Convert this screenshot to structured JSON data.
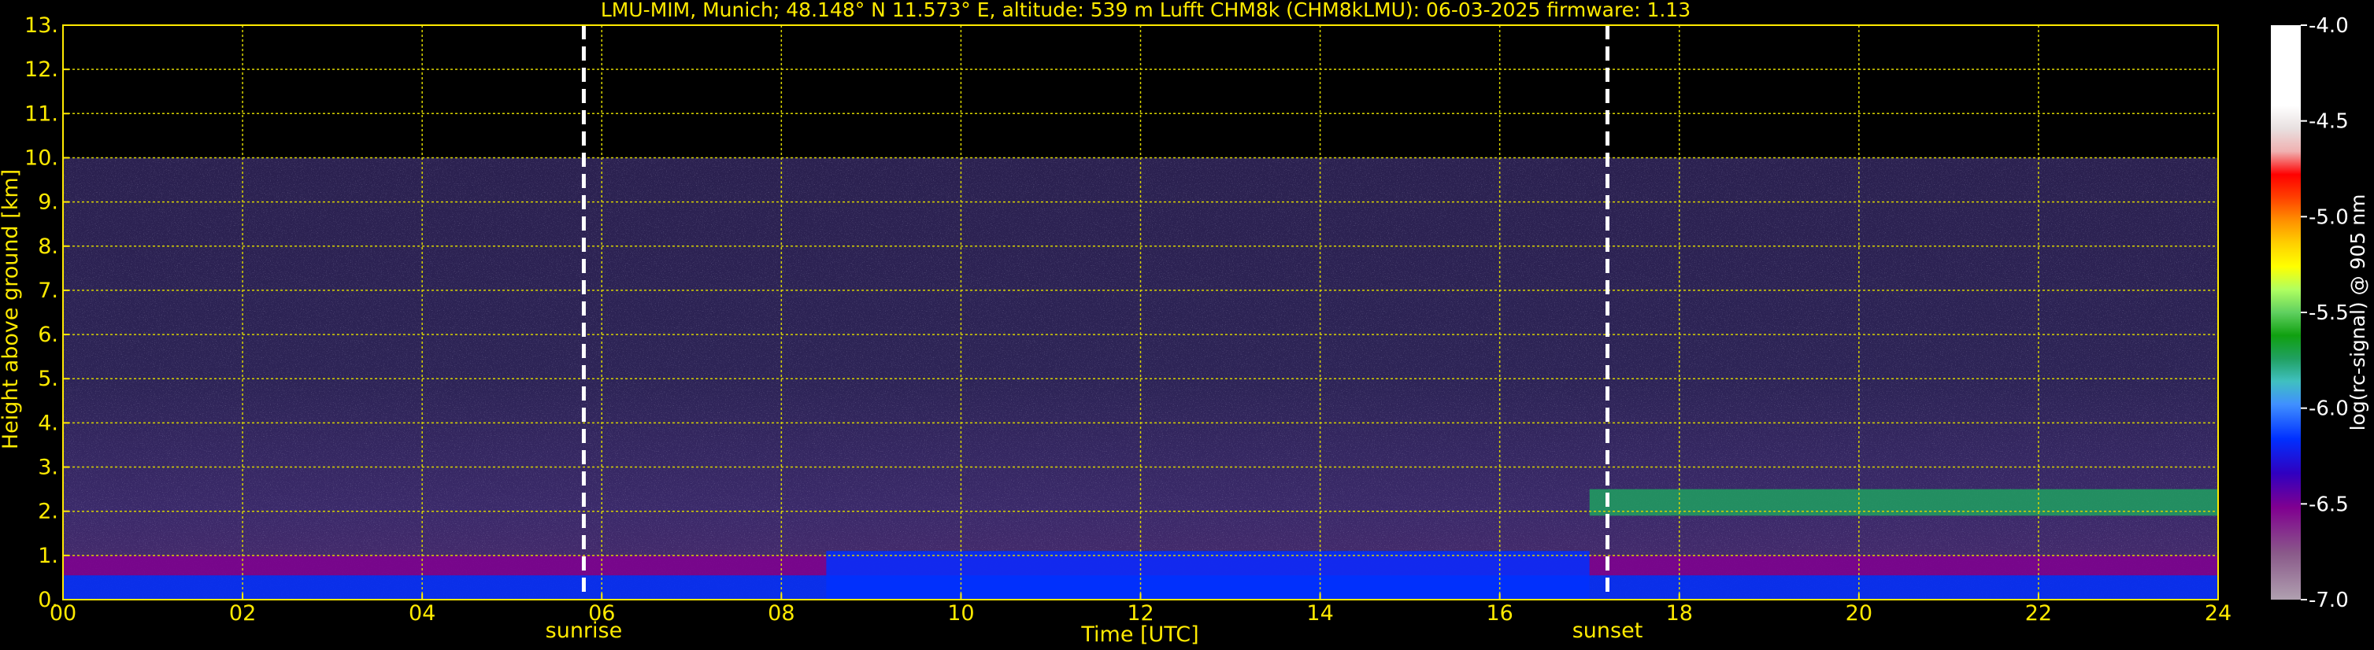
{
  "chart_data": {
    "type": "heatmap",
    "title": "LMU-MIM, Munich; 48.148° N 11.573° E, altitude: 539 m    Lufft CHM8k (CHM8kLMU): 06-03-2025    firmware: 1.13",
    "xlabel": "Time [UTC]",
    "ylabel": "Height above ground [km]",
    "xlim": [
      0,
      24
    ],
    "ylim": [
      0,
      13
    ],
    "x_ticks": [
      "00",
      "02",
      "04",
      "06",
      "08",
      "10",
      "12",
      "14",
      "16",
      "18",
      "20",
      "22",
      "24"
    ],
    "y_ticks": [
      "0.",
      "1.",
      "2.",
      "3.",
      "4.",
      "5.",
      "6.",
      "7.",
      "8.",
      "9.",
      "10.",
      "11.",
      "12.",
      "13."
    ],
    "grid": true,
    "measurement_top_km": 10,
    "events": [
      {
        "label": "sunrise",
        "time": 5.8
      },
      {
        "label": "sunset",
        "time": 17.2
      }
    ],
    "colorbar": {
      "label": "log(rc-signal) @ 905 nm",
      "range": [
        -7.0,
        -4.0
      ],
      "ticks": [
        "-4.0",
        "-4.5",
        "-5.0",
        "-5.5",
        "-6.0",
        "-6.5",
        "-7.0"
      ]
    },
    "layers": [
      {
        "time_start": 0,
        "time_end": 24,
        "height_bottom": 0.0,
        "height_top": 0.55,
        "value": -6.4
      },
      {
        "time_start": 0,
        "time_end": 24,
        "height_bottom": 0.55,
        "height_top": 1.0,
        "value": -6.7
      },
      {
        "time_start": 8.5,
        "time_end": 17,
        "height_bottom": 0.0,
        "height_top": 1.1,
        "value": -6.4
      },
      {
        "time_start": 17,
        "time_end": 24,
        "height_bottom": 1.9,
        "height_top": 2.5,
        "value": -6.1
      }
    ]
  },
  "colors": {
    "text": "#ffea00",
    "grid": "#d9d400",
    "colorbar_text": "#ffffff"
  }
}
